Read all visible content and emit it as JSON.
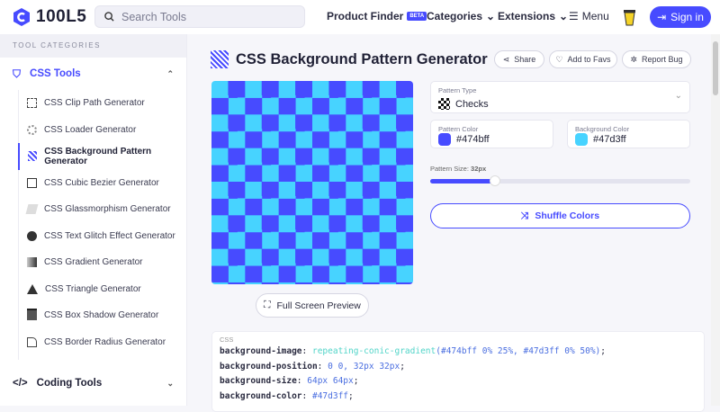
{
  "header": {
    "logo": "100L5",
    "search_placeholder": "Search Tools",
    "nav": {
      "product_finder": "Product Finder",
      "beta": "BETA",
      "categories": "Categories",
      "extensions": "Extensions",
      "menu": "Menu"
    },
    "sign_in": "Sign in"
  },
  "sidebar": {
    "heading": "TOOL CATEGORIES",
    "css_tools": "CSS Tools",
    "items": [
      {
        "label": "CSS Clip Path Generator",
        "icon": "clip-path-icon"
      },
      {
        "label": "CSS Loader Generator",
        "icon": "loader-icon"
      },
      {
        "label": "CSS Background Pattern Generator",
        "icon": "pattern-icon",
        "active": true
      },
      {
        "label": "CSS Cubic Bezier Generator",
        "icon": "bezier-icon"
      },
      {
        "label": "CSS Glassmorphism Generator",
        "icon": "glass-icon"
      },
      {
        "label": "CSS Text Glitch Effect Generator",
        "icon": "glitch-icon"
      },
      {
        "label": "CSS Gradient Generator",
        "icon": "gradient-icon"
      },
      {
        "label": "CSS Triangle Generator",
        "icon": "triangle-icon"
      },
      {
        "label": "CSS Box Shadow Generator",
        "icon": "box-shadow-icon"
      },
      {
        "label": "CSS Border Radius Generator",
        "icon": "border-radius-icon"
      }
    ],
    "coding_tools": "Coding Tools"
  },
  "main": {
    "title": "CSS Background Pattern Generator",
    "share": "Share",
    "favs": "Add to Favs",
    "report": "Report Bug",
    "full_screen": "Full Screen Preview",
    "pattern_type": {
      "label": "Pattern Type",
      "value": "Checks"
    },
    "pattern_color": {
      "label": "Pattern Color",
      "value": "#474bff"
    },
    "background_color": {
      "label": "Background Color",
      "value": "#47d3ff"
    },
    "pattern_size": {
      "label": "Pattern Size:",
      "value": "32px",
      "fraction": 0.25
    },
    "shuffle": "Shuffle Colors",
    "code": {
      "label": "CSS",
      "l1p": "background-image",
      "l1f": "repeating-conic-gradient",
      "l1a": "(#474bff 0% 25%, #47d3ff 0% 50%)",
      "l2p": "background-position",
      "l2v": "0 0, 32px 32px",
      "l3p": "background-size",
      "l3v": "64px 64px",
      "l4p": "background-color",
      "l4v": "#47d3ff"
    }
  },
  "colors": {
    "accent": "#474bff",
    "pattern": "#474bff",
    "background": "#47d3ff"
  }
}
